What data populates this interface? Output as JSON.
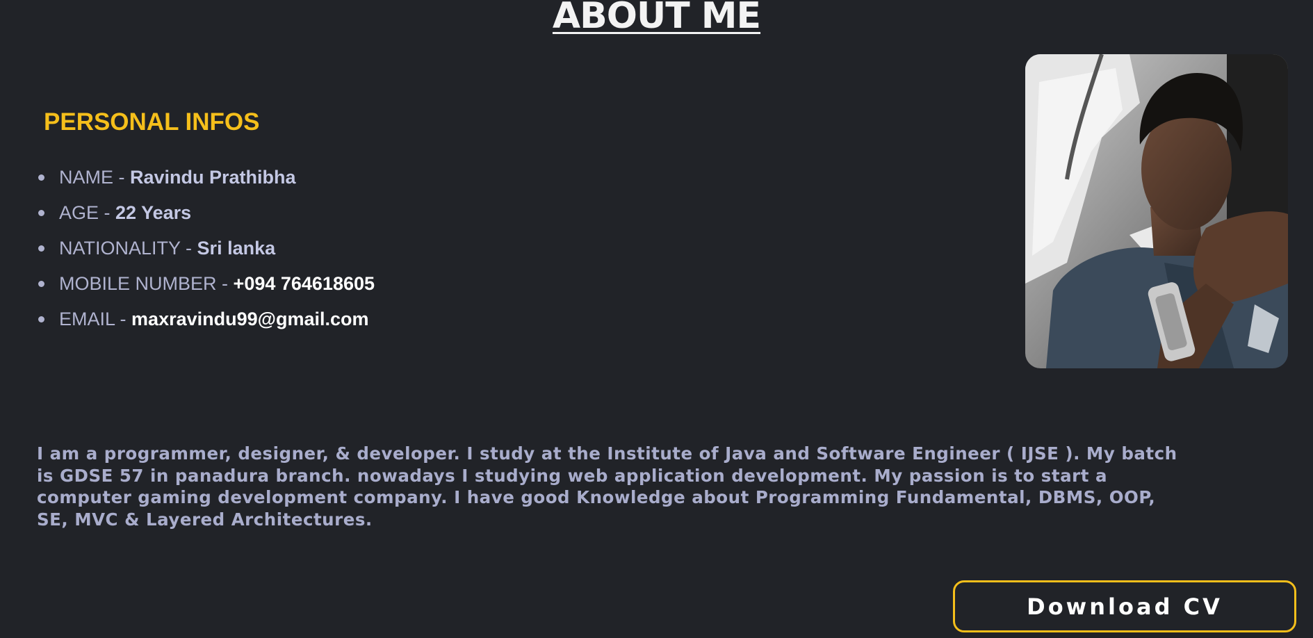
{
  "page_title": "ABOUT ME",
  "personal": {
    "heading": "PERSONAL INFOS",
    "items": [
      {
        "label": "NAME - ",
        "value": "Ravindu Prathibha"
      },
      {
        "label": "AGE - ",
        "value": "22 Years"
      },
      {
        "label": "NATIONALITY - ",
        "value": "Sri lanka"
      },
      {
        "label": "MOBILE NUMBER - ",
        "value": "+094 764618605"
      },
      {
        "label": "EMAIL - ",
        "value": "maxravindu99@gmail.com"
      }
    ]
  },
  "bio": "I am a programmer, designer, & developer. I study at the Institute of Java and Software Engineer ( IJSE ). My batch is GDSE 57 in panadura branch. nowadays I studying web application development. My passion is to start a computer gaming development company. I have good Knowledge about Programming Fundamental, DBMS, OOP, SE, MVC & Layered Architectures.",
  "download_button": "Download CV",
  "colors": {
    "background": "#212328",
    "accent": "#f5bf1b",
    "text_muted": "#b0b3cf",
    "text_bright": "#ffffff"
  }
}
